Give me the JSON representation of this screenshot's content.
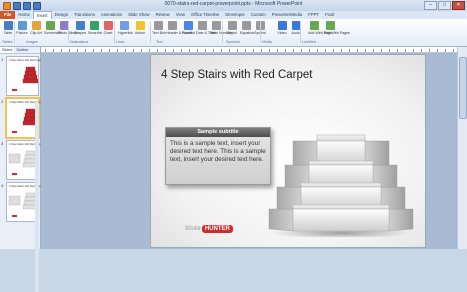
{
  "window": {
    "title": "0070-stairs-red-carpet-powerpoint.pptx - Microsoft PowerPoint",
    "controls": [
      "–",
      "□",
      "✕"
    ]
  },
  "tabs": [
    "File",
    "Home",
    "Insert",
    "Design",
    "Transitions",
    "Animations",
    "Slide Show",
    "Review",
    "View",
    "Office Timeline",
    "Developer",
    "Custom",
    "PresenterMedia",
    "FPPT",
    "Foxit"
  ],
  "active_tab": "Insert",
  "ribbon": {
    "buttons": [
      {
        "label": "Table",
        "color": "#4a7bc4"
      },
      {
        "label": "Picture",
        "color": "#5a9bd4"
      },
      {
        "label": "Clip Art",
        "color": "#e6a23c"
      },
      {
        "label": "Screenshot",
        "color": "#6aa84f"
      },
      {
        "label": "Photo Album",
        "color": "#8e7cc3"
      },
      {
        "label": "Shapes",
        "color": "#3d85c6"
      },
      {
        "label": "SmartArt",
        "color": "#38a169"
      },
      {
        "label": "Chart",
        "color": "#e06666"
      },
      {
        "label": "Hyperlink",
        "color": "#6d9eeb"
      },
      {
        "label": "Action",
        "color": "#f1c232"
      },
      {
        "label": "Text Box",
        "color": "#999999"
      },
      {
        "label": "Header & Footer",
        "color": "#999999"
      },
      {
        "label": "WordArt",
        "color": "#4a86e8"
      },
      {
        "label": "Date & Time",
        "color": "#999999"
      },
      {
        "label": "Slide Number",
        "color": "#999999"
      },
      {
        "label": "Object",
        "color": "#999999"
      },
      {
        "label": "Equation",
        "color": "#999999"
      },
      {
        "label": "Symbol",
        "color": "#999999"
      },
      {
        "label": "Video",
        "color": "#3c78d8"
      },
      {
        "label": "Audio",
        "color": "#3c78d8"
      },
      {
        "label": "Add Web Page",
        "color": "#6aa84f"
      },
      {
        "label": "Add Web Pages",
        "color": "#6aa84f"
      }
    ],
    "groups": [
      "Tables",
      "Images",
      "Illustrations",
      "Links",
      "Text",
      "Symbols",
      "Media",
      "LiveWeb"
    ]
  },
  "slides_pane": {
    "tabs": [
      "Slides",
      "Outline"
    ],
    "slides": [
      {
        "num": "1",
        "title": "4 Step Stairs with Red Carpet"
      },
      {
        "num": "2",
        "title": "4 Step Stairs with Red Carpet"
      },
      {
        "num": "3",
        "title": "4 Step Stairs with Red Carpet"
      },
      {
        "num": "4",
        "title": "4 Step Stairs with Red Carpet"
      }
    ],
    "selected": 2
  },
  "slide": {
    "title": "4 Step Stairs with Red Carpet",
    "box_title": "Sample subtitle",
    "box_text": "This is a sample text, insert your desired text here. This is a sample text, insert your desired text here.",
    "logo_a": "Slide",
    "logo_b": "HUNTER"
  }
}
